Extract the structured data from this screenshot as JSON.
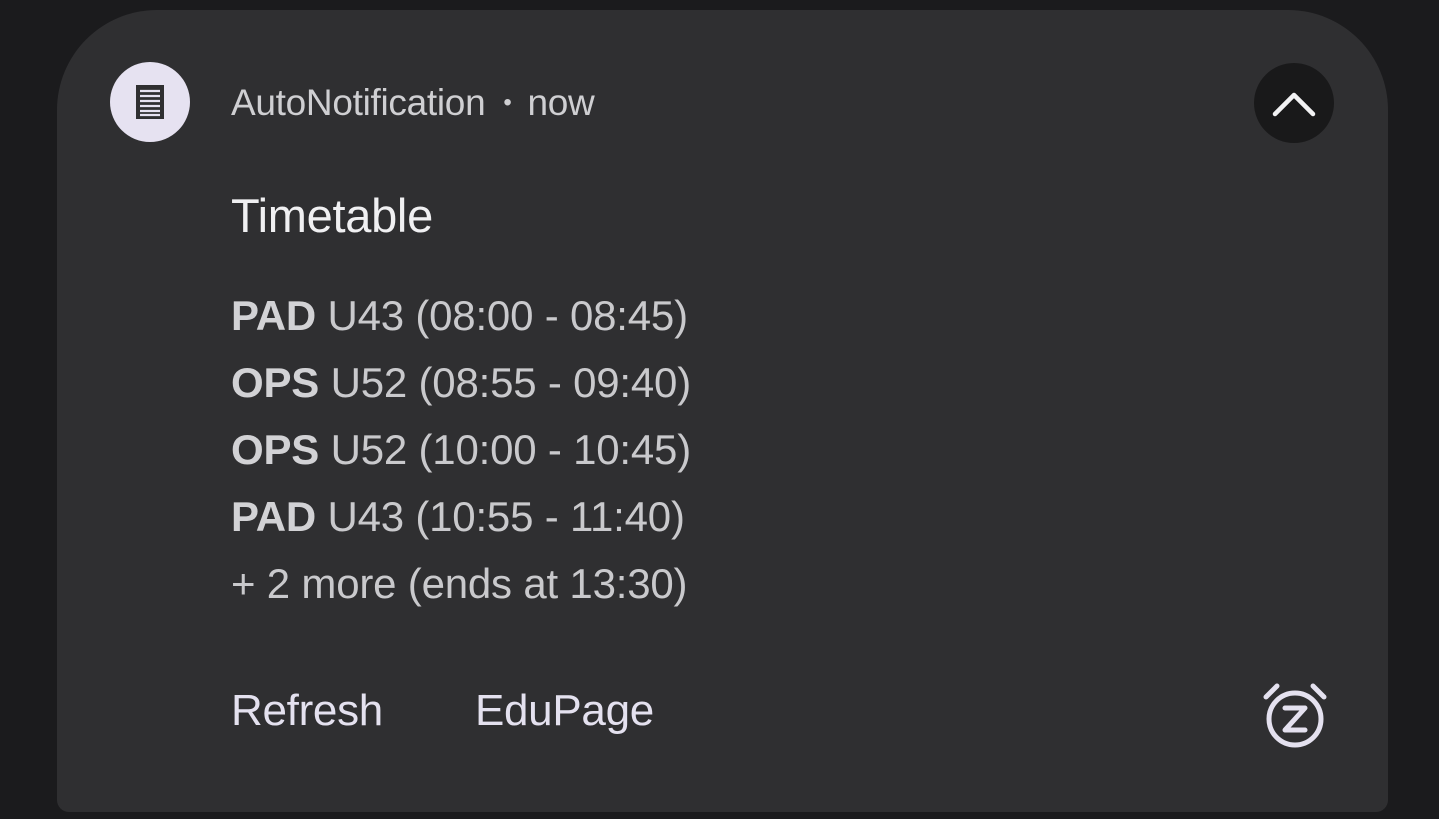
{
  "notification": {
    "app_name": "AutoNotification",
    "separator": "•",
    "time": "now",
    "app_icon": "document-lines-icon",
    "expand_icon": "chevron-up-icon",
    "title": "Timetable",
    "entries": [
      {
        "subject": "PAD",
        "detail": " U43 (08:00 - 08:45)"
      },
      {
        "subject": "OPS",
        "detail": " U52 (08:55 - 09:40)"
      },
      {
        "subject": "OPS",
        "detail": " U52 (10:00 - 10:45)"
      },
      {
        "subject": "PAD",
        "detail": " U43 (10:55 - 11:40)"
      }
    ],
    "more": "+ 2 more (ends at 13:30)",
    "actions": {
      "refresh": "Refresh",
      "edupage": "EduPage"
    },
    "snooze_icon": "snooze-alarm-icon"
  },
  "colors": {
    "background": "#1b1b1d",
    "card": "#2f2f31",
    "app_icon_bg": "#e6e2f1",
    "collapse_bg": "#19191a",
    "action_text": "#e4e1ef"
  }
}
